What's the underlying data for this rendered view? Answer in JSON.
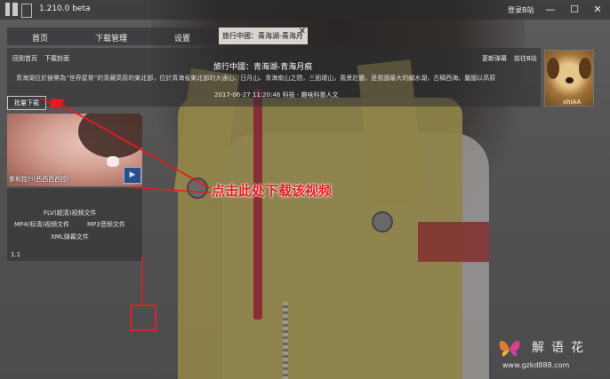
{
  "window": {
    "title": "1.210.0 beta",
    "login_link": "登录B站",
    "controls": {
      "minimize": "—",
      "maximize": "☐",
      "close": "✕"
    }
  },
  "tabs": {
    "home": "首页",
    "download_manager": "下载管理",
    "settings": "设置",
    "video_tab": "旅行中國：青海湖-青海月",
    "video_tab_close": "✕"
  },
  "video_page": {
    "back_home": "回到首页",
    "download_cover": "下载封面",
    "update_danmaku": "更新弹幕",
    "go_bilibili": "前往B站",
    "title": "旅行中國：青海湖-青海月痕",
    "description": "青海湖位於被譽為“世界屋脊”的青藏高原的東北部，位於青海省東北部的大通山、日月山、青海南山之間，三面環山，風景壯麗，是我國最大的鹹水湖，古稱西海。屬國以高原",
    "meta": "2017-06-27 11:20:46  科技 - 趣味科普人文"
  },
  "uploader": {
    "name": "xhiAA"
  },
  "left_panel": {
    "batch_download": "批量下载",
    "thumbnail_caption": "爹和控?!(西西西西控!",
    "play_icon": "▶",
    "options": {
      "flv": "FLV(超清)视频文件",
      "mp4": "MP4(标清)视频文件",
      "mp3": "MP3音频文件",
      "xml": "XML弹幕文件"
    },
    "version": "1.1"
  },
  "annotation": {
    "callout": "点击此处下载该视频",
    "color": "#e8191f"
  },
  "watermark": {
    "name": "解语花",
    "url": "www.gzkd888.com"
  }
}
